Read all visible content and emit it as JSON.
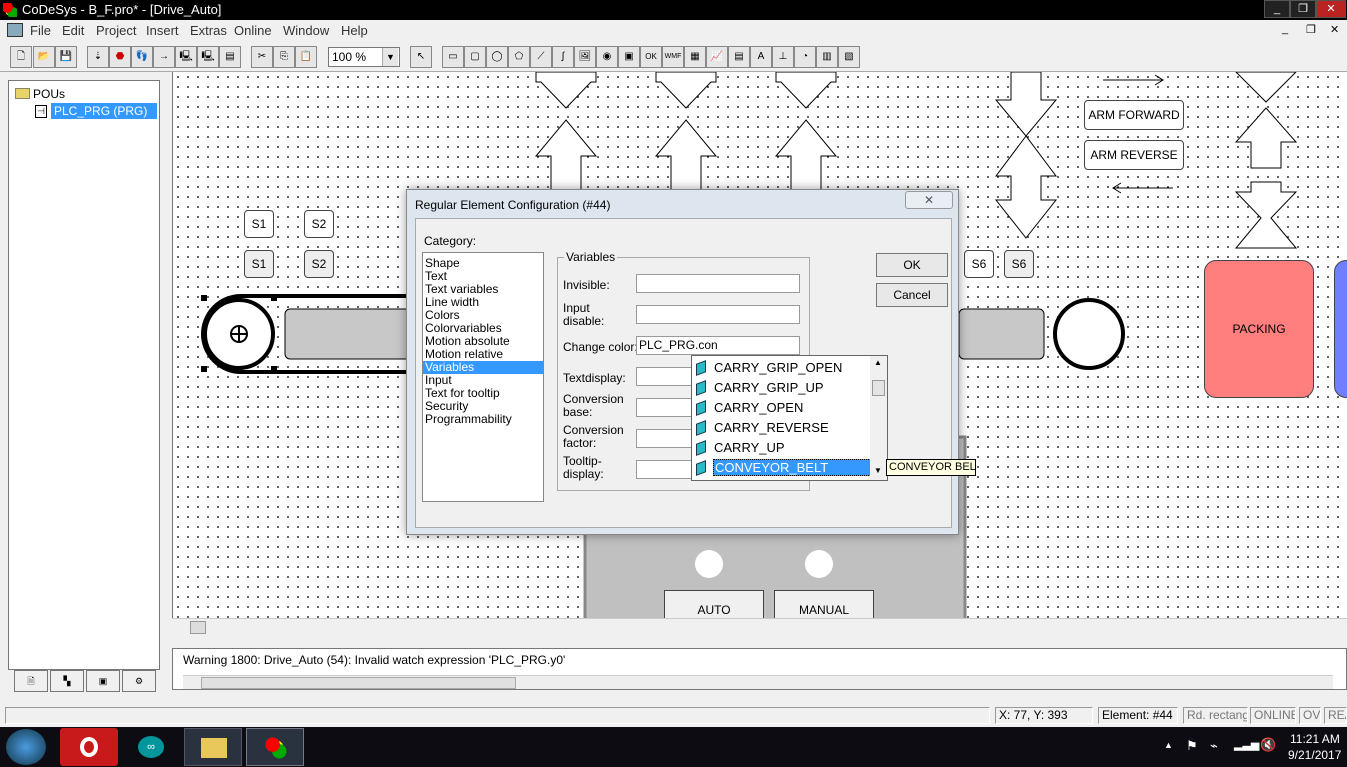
{
  "window": {
    "title": "CoDeSys - B_F.pro* - [Drive_Auto]",
    "controls": [
      "minimize",
      "restore",
      "close"
    ]
  },
  "menu": [
    "File",
    "Edit",
    "Project",
    "Insert",
    "Extras",
    "Online",
    "Window",
    "Help"
  ],
  "toolbar": {
    "zoom": "100 %",
    "icons": [
      "new",
      "open",
      "save",
      "login",
      "stop",
      "step",
      "breakpoint",
      "online",
      "offline",
      "config",
      "cut",
      "copy",
      "paste"
    ]
  },
  "tree": {
    "root": "POUs",
    "items": [
      {
        "label": "PLC_PRG (PRG)",
        "selected": true
      }
    ]
  },
  "canvas": {
    "buttons": [
      "S1",
      "S2",
      "S1",
      "S2",
      "S6",
      "S6",
      "ARM FORWARD",
      "ARM REVERSE",
      "AUTO",
      "MANUAL"
    ],
    "packing": "PACKING",
    "colors": {
      "packing": "#ff7f7f",
      "panel": "#c0c0c0"
    }
  },
  "dialog": {
    "title": "Regular Element Configuration (#44)",
    "category_label": "Category:",
    "categories": [
      "Shape",
      "Text",
      "Text variables",
      "Line width",
      "Colors",
      "Colorvariables",
      "Motion absolute",
      "Motion relative",
      "Variables",
      "Input",
      "Text for tooltip",
      "Security",
      "Programmability"
    ],
    "selected_category": "Variables",
    "group": "Variables",
    "fields": [
      {
        "label": "Invisible:",
        "value": ""
      },
      {
        "label": "Input disable:",
        "value": ""
      },
      {
        "label": "Change color:",
        "value": "PLC_PRG.con"
      },
      {
        "label": "Textdisplay:",
        "value": ""
      },
      {
        "label": "Conversion base:",
        "value": ""
      },
      {
        "label": "Conversion factor:",
        "value": ""
      },
      {
        "label": "Tooltip-display:",
        "value": ""
      }
    ],
    "ok": "OK",
    "cancel": "Cancel",
    "autocomplete": [
      "CARRY_GRIP_OPEN",
      "CARRY_GRIP_UP",
      "CARRY_OPEN",
      "CARRY_REVERSE",
      "CARRY_UP",
      "CONVEYOR_BELT"
    ],
    "autocomplete_selected": "CONVEYOR_BELT",
    "tooltip": "CONVEYOR BELT"
  },
  "messages": [
    "Warning 1800: Drive_Auto (54): Invalid watch expression 'PLC_PRG.y0'"
  ],
  "status": {
    "coords": "X:     77, Y:    393",
    "element": "Element: #44",
    "shape": "Rd. rectangle",
    "online": "ONLINE",
    "ov": "OV",
    "read": "READ"
  },
  "taskbar": {
    "time": "11:21 AM",
    "date": "9/21/2017",
    "apps": [
      "Opera",
      "Arduino",
      "File Explorer",
      "CoDeSys"
    ]
  }
}
